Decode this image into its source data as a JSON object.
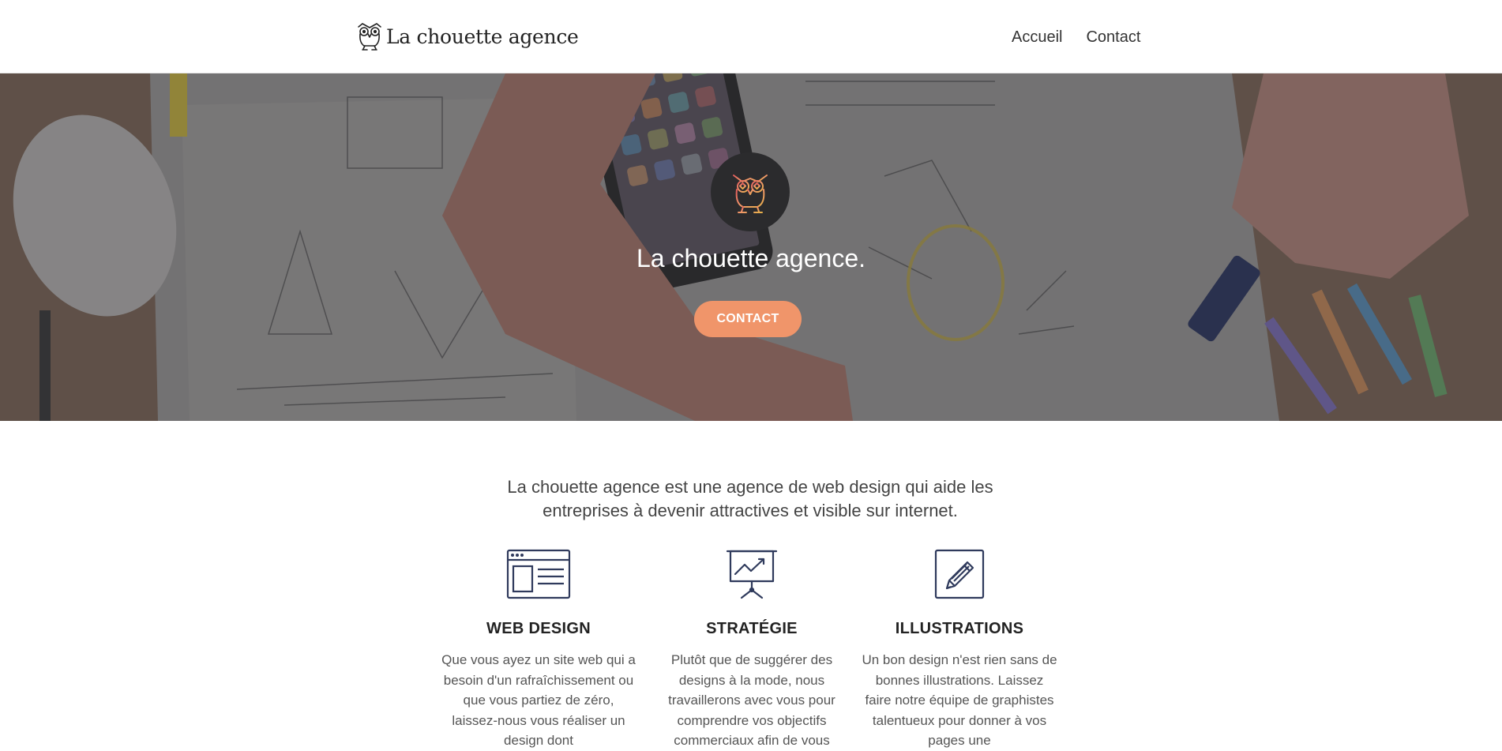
{
  "header": {
    "brand_name": "La chouette agence",
    "nav": [
      {
        "label": "Accueil"
      },
      {
        "label": "Contact"
      }
    ]
  },
  "hero": {
    "title": "La chouette agence.",
    "button_label": "CONTACT"
  },
  "intro": {
    "text": "La chouette agence est une agence de web design qui aide les entreprises à devenir attractives et visible sur internet."
  },
  "features": [
    {
      "icon": "web-layout-icon",
      "title": "WEB DESIGN",
      "text": "Que vous ayez un site web qui a besoin d'un rafraîchissement ou que vous partiez de zéro, laissez-nous vous réaliser un design dont"
    },
    {
      "icon": "presentation-chart-icon",
      "title": "STRATÉGIE",
      "text": "Plutôt que de suggérer des designs à la mode, nous travaillerons avec vous pour comprendre vos objectifs commerciaux afin de vous"
    },
    {
      "icon": "pencil-icon",
      "title": "ILLUSTRATIONS",
      "text": "Un bon design n'est rien sans de bonnes illustrations. Laissez faire notre équipe de graphistes talentueux pour donner à vos pages une"
    }
  ],
  "colors": {
    "accent": "#f0956a",
    "icon_navy": "#2f3a5c",
    "badge_bg": "#2b2b2d"
  }
}
